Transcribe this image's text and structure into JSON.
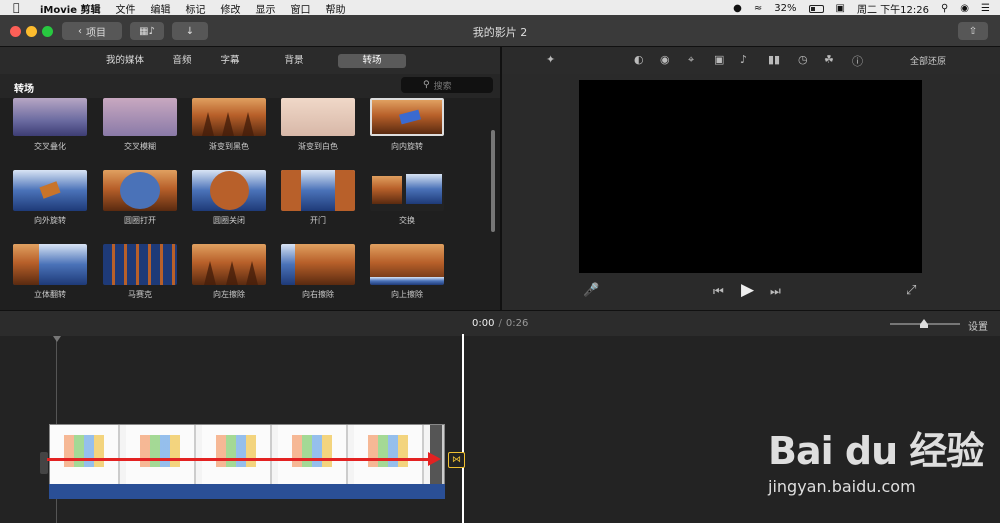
{
  "menubar": {
    "app_name": "iMovie 剪辑",
    "menus": [
      "文件",
      "编辑",
      "标记",
      "修改",
      "显示",
      "窗口",
      "帮助"
    ],
    "battery": "32%",
    "clock": "周二 下午12:26"
  },
  "titlebar": {
    "back_label": "项目",
    "title": "我的影片 2"
  },
  "browser": {
    "tabs": [
      "我的媒体",
      "音频",
      "字幕",
      "背景",
      "转场"
    ],
    "active_tab": "转场",
    "section_title": "转场",
    "search_placeholder": "搜索",
    "items": [
      "交叉叠化",
      "交叉模糊",
      "渐变到黑色",
      "渐变到白色",
      "向内旋转",
      "向外旋转",
      "圆圈打开",
      "圆圈关闭",
      "开门",
      "交换",
      "立体翻转",
      "马赛克",
      "向左擦除",
      "向右擦除",
      "向上擦除"
    ]
  },
  "viewer": {
    "reset_all": "全部还原"
  },
  "timeline": {
    "current_time": "0:00",
    "separator": "/",
    "total_time": "0:26",
    "settings_label": "设置"
  },
  "watermark": {
    "brand": "Bai du 经验",
    "url": "jingyan.baidu.com"
  },
  "colors": {
    "accent_arrow": "#e32222",
    "transition_marker": "#f0c030",
    "clip_strip": "#2a4f96"
  }
}
